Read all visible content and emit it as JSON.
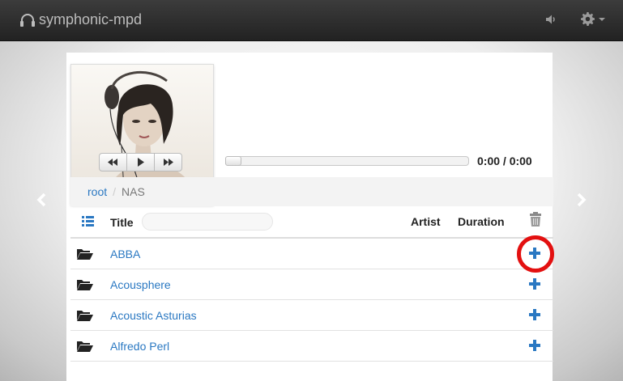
{
  "app": {
    "title": "symphonic-mpd"
  },
  "navbar": {
    "volume_icon": "volume-icon",
    "settings_icon": "gear-icon"
  },
  "player": {
    "elapsed_time": "0:00 / 0:00",
    "progress_fraction": 0,
    "controls": [
      "previous-icon",
      "play-icon",
      "next-icon"
    ]
  },
  "breadcrumb": {
    "items": [
      "root",
      "NAS"
    ],
    "separator": "/"
  },
  "table": {
    "headers": {
      "title": "Title",
      "artist": "Artist",
      "duration": "Duration"
    },
    "rows": [
      {
        "name": "ABBA",
        "icon": "folder-open-icon",
        "action_icon": "plus-icon"
      },
      {
        "name": "Acousphere",
        "icon": "folder-open-icon",
        "action_icon": "plus-icon"
      },
      {
        "name": "Acoustic Asturias",
        "icon": "folder-open-icon",
        "action_icon": "plus-icon"
      },
      {
        "name": "Alfredo Perl",
        "icon": "folder-open-icon",
        "action_icon": "plus-icon"
      }
    ]
  },
  "colors": {
    "link": "#2a78c2",
    "navbar": "#2b2b2b",
    "highlight_ring": "#e31010"
  }
}
